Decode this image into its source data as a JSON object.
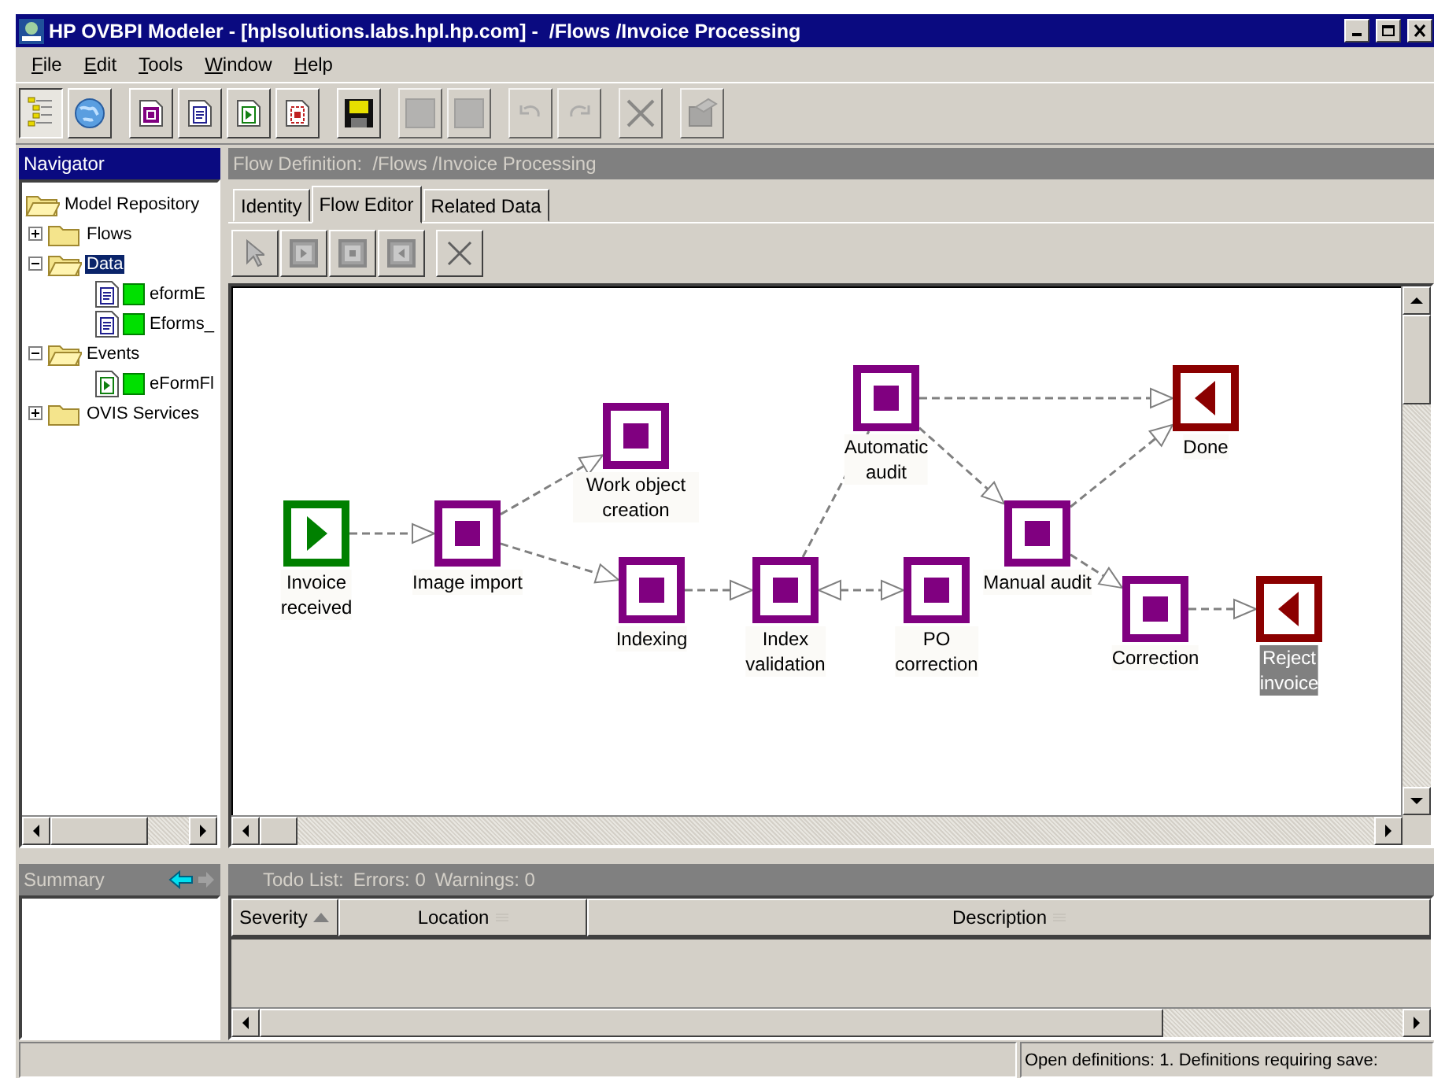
{
  "window": {
    "title": "HP OVBPI Modeler - [hplsolutions.labs.hpl.hp.com] -  /Flows /Invoice Processing"
  },
  "menu": [
    "File",
    "Edit",
    "Tools",
    "Window",
    "Help"
  ],
  "toolbar": [
    {
      "kind": "outline",
      "selected": true,
      "disabled": false
    },
    {
      "kind": "globe",
      "selected": false,
      "disabled": false
    },
    {
      "kind": "process",
      "selected": false,
      "disabled": false
    },
    {
      "kind": "data",
      "selected": false,
      "disabled": false
    },
    {
      "kind": "event",
      "selected": false,
      "disabled": false
    },
    {
      "kind": "service",
      "selected": false,
      "disabled": false
    },
    {
      "kind": "save",
      "selected": false,
      "disabled": false
    },
    {
      "kind": "blank",
      "selected": false,
      "disabled": true
    },
    {
      "kind": "blank",
      "selected": false,
      "disabled": true
    },
    {
      "kind": "undo",
      "selected": false,
      "disabled": true
    },
    {
      "kind": "redo",
      "selected": false,
      "disabled": true
    },
    {
      "kind": "delete",
      "selected": false,
      "disabled": true
    },
    {
      "kind": "properties",
      "selected": false,
      "disabled": true
    }
  ],
  "navigator": {
    "title": "Navigator",
    "tree": [
      {
        "label": "Model Repository",
        "kind": "root",
        "selected": false,
        "children": [
          {
            "label": "Flows",
            "kind": "folder",
            "expanded": false,
            "selected": false
          },
          {
            "label": "Data",
            "kind": "folder",
            "expanded": true,
            "selected": true,
            "children": [
              {
                "label": "eformE",
                "kind": "data",
                "selected": false
              },
              {
                "label": "Eforms_",
                "kind": "data",
                "selected": false
              }
            ]
          },
          {
            "label": "Events",
            "kind": "folder",
            "expanded": true,
            "selected": false,
            "children": [
              {
                "label": "eFormFl",
                "kind": "event",
                "selected": false
              }
            ]
          },
          {
            "label": "OVIS Services",
            "kind": "folder",
            "expanded": false,
            "selected": false
          }
        ]
      }
    ]
  },
  "flow_definition": {
    "title": "Flow Definition:  /Flows /Invoice Processing",
    "tabs": [
      {
        "label": "Identity",
        "selected": false
      },
      {
        "label": "Flow Editor",
        "selected": true
      },
      {
        "label": "Related Data",
        "selected": false
      }
    ],
    "tools": [
      {
        "kind": "pointer"
      },
      {
        "kind": "start"
      },
      {
        "kind": "activity"
      },
      {
        "kind": "end"
      },
      {
        "kind": "delete"
      }
    ],
    "nodes": [
      {
        "label": "Invoice received",
        "kind": "start",
        "selected": false
      },
      {
        "label": "Image import",
        "kind": "activity",
        "selected": false
      },
      {
        "label": "Work object creation",
        "kind": "activity",
        "selected": false
      },
      {
        "label": "Indexing",
        "kind": "activity",
        "selected": false
      },
      {
        "label": "Index validation",
        "kind": "activity",
        "selected": false
      },
      {
        "label": "PO correction",
        "kind": "activity",
        "selected": false
      },
      {
        "label": "Automatic audit",
        "kind": "activity",
        "selected": false
      },
      {
        "label": "Manual audit",
        "kind": "activity",
        "selected": false
      },
      {
        "label": "Done",
        "kind": "end",
        "selected": false
      },
      {
        "label": "Correction",
        "kind": "activity",
        "selected": false
      },
      {
        "label": "Reject invoice",
        "kind": "end",
        "selected": true
      }
    ]
  },
  "summary": {
    "title": "Summary"
  },
  "todo": {
    "title": "Todo List:",
    "errors": "Errors: 0",
    "warnings": "Warnings: 0",
    "columns": [
      {
        "label": "Severity",
        "sorted": true
      },
      {
        "label": "Location",
        "sorted": false
      },
      {
        "label": "Description",
        "sorted": false
      }
    ]
  },
  "status_bar": {
    "message": "Open definitions: 1. Definitions requiring save:"
  }
}
